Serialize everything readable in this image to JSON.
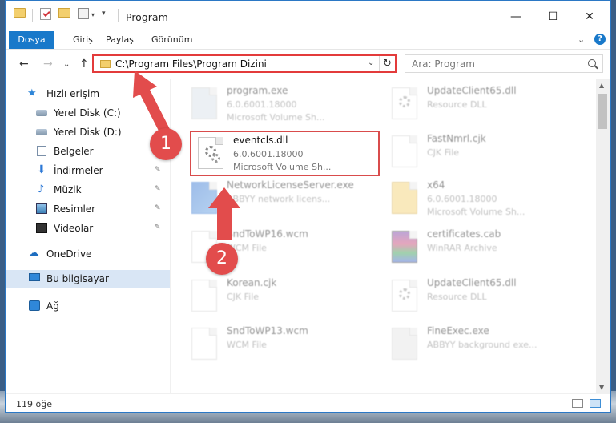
{
  "window": {
    "title": "Program",
    "minimize": "—",
    "maximize": "☐",
    "close": "✕"
  },
  "ribbon": {
    "tabs": [
      "Dosya",
      "Giriş",
      "Paylaş",
      "Görünüm"
    ],
    "expand": "⌄",
    "help": "?"
  },
  "address": {
    "path": "C:\\Program Files\\Program Dizini",
    "dropdown": "⌄",
    "refresh": "↻",
    "search_placeholder": "Ara: Program",
    "back": "←",
    "forward": "→",
    "recent": "⌄",
    "up": "↑"
  },
  "sidebar": {
    "items": [
      {
        "label": "Hızlı erişim",
        "icon": "star-icon"
      },
      {
        "label": "Yerel Disk (C:)",
        "icon": "disk-icon"
      },
      {
        "label": "Yerel Disk (D:)",
        "icon": "disk-icon"
      },
      {
        "label": "Belgeler",
        "icon": "document-icon"
      },
      {
        "label": "İndirmeler",
        "icon": "download-icon"
      },
      {
        "label": "Müzik",
        "icon": "music-icon"
      },
      {
        "label": "Resimler",
        "icon": "picture-icon"
      },
      {
        "label": "Videolar",
        "icon": "video-icon"
      },
      {
        "label": "OneDrive",
        "icon": "cloud-icon"
      },
      {
        "label": "Bu bilgisayar",
        "icon": "computer-icon"
      },
      {
        "label": "Ağ",
        "icon": "network-icon"
      }
    ],
    "pin": "📌"
  },
  "files": [
    {
      "name": "program.exe",
      "line1": "6.0.6001.18000",
      "line2": "Microsoft Volume Sh...",
      "icon": "exe-icon"
    },
    {
      "name": "UpdateClient65.dll",
      "line1": "Resource DLL",
      "line2": "",
      "icon": "dll-icon"
    },
    {
      "name": "eventcls.dll",
      "line1": "6.0.6001.18000",
      "line2": "Microsoft Volume Sh...",
      "icon": "dll-icon"
    },
    {
      "name": "FastNmrl.cjk",
      "line1": "CJK File",
      "line2": "",
      "icon": "file-icon"
    },
    {
      "name": "NetworkLicenseServer.exe",
      "line1": "ABBYY network licens...",
      "line2": "",
      "icon": "app-icon"
    },
    {
      "name": "x64",
      "line1": "6.0.6001.18000",
      "line2": "Microsoft Volume Sh...",
      "icon": "folder-icon"
    },
    {
      "name": "SndToWP16.wcm",
      "line1": "WCM File",
      "line2": "",
      "icon": "file-icon"
    },
    {
      "name": "certificates.cab",
      "line1": "WinRAR Archive",
      "line2": "",
      "icon": "archive-icon"
    },
    {
      "name": "Korean.cjk",
      "line1": "CJK File",
      "line2": "",
      "icon": "file-icon"
    },
    {
      "name": "UpdateClient65.dll",
      "line1": "Resource DLL",
      "line2": "",
      "icon": "dll-icon"
    },
    {
      "name": "SndToWP13.wcm",
      "line1": "WCM File",
      "line2": "",
      "icon": "file-icon"
    },
    {
      "name": "FineExec.exe",
      "line1": "ABBYY background exe...",
      "line2": "",
      "icon": "exe-icon"
    }
  ],
  "status": {
    "count": "119 öğe"
  },
  "annotations": {
    "step1": "1",
    "step2": "2"
  },
  "colors": {
    "accent": "#1979ca",
    "highlight": "#e24c4c"
  }
}
